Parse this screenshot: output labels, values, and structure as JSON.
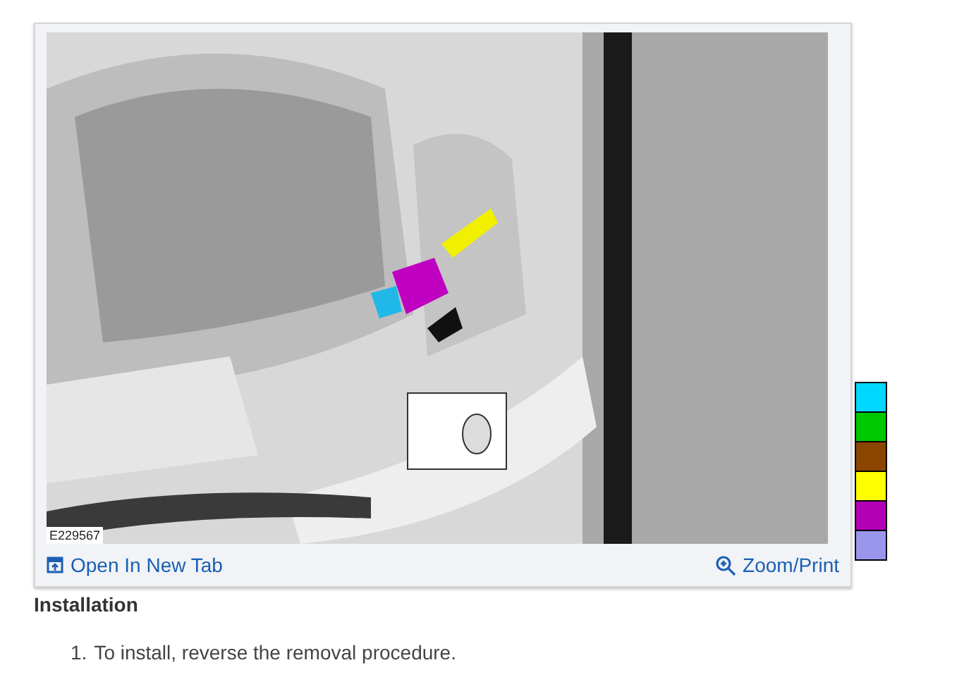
{
  "figure": {
    "kind": "picture",
    "figure_id": "E229567",
    "open_link": "Open In New Tab",
    "zoom_link": "Zoom/Print"
  },
  "color_key": [
    {
      "color": "#00d8ff"
    },
    {
      "color": "#00c800"
    },
    {
      "color": "#8b4500"
    },
    {
      "color": "#ffff00"
    },
    {
      "color": "#b400b4"
    },
    {
      "color": "#9a96ee"
    }
  ],
  "section": {
    "heading": "Installation",
    "steps": [
      {
        "number": "1.",
        "text": "To install, reverse the removal procedure."
      }
    ]
  }
}
